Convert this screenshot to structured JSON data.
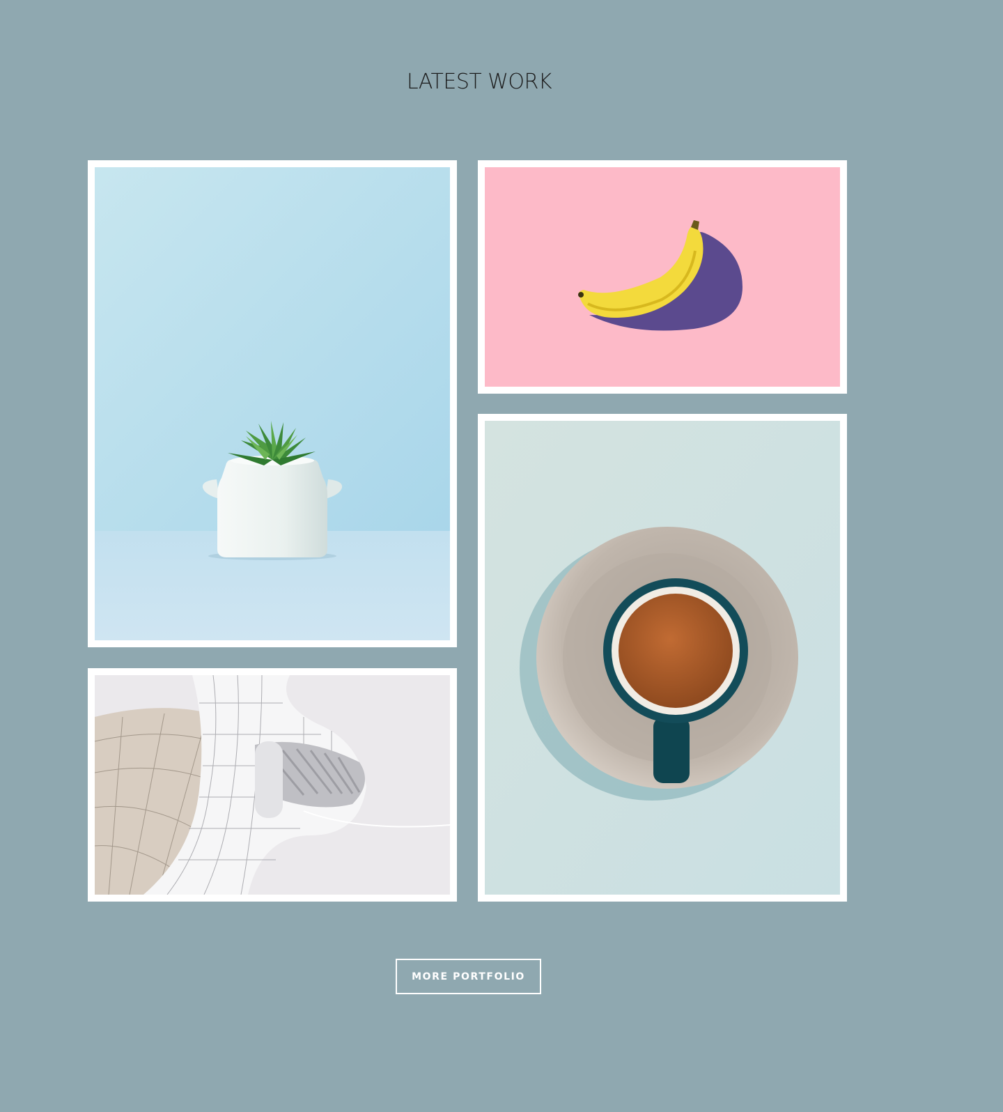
{
  "section": {
    "title": "LATEST WORK"
  },
  "portfolio": {
    "items": [
      {
        "subject": "succulent-in-white-pot",
        "background": "#b7dcea"
      },
      {
        "subject": "banana-on-pink",
        "background": "#fdbac8"
      },
      {
        "subject": "coffee-cup-on-saucer",
        "background": "#cbe0e0"
      },
      {
        "subject": "curved-white-architecture",
        "background": "#e9e8ea"
      }
    ]
  },
  "actions": {
    "more_label": "MORE PORTFOLIO"
  },
  "colors": {
    "page_background": "#8fa8b0",
    "card_border": "#ffffff",
    "title_text": "#1b1b1b",
    "button_text": "#ffffff"
  }
}
